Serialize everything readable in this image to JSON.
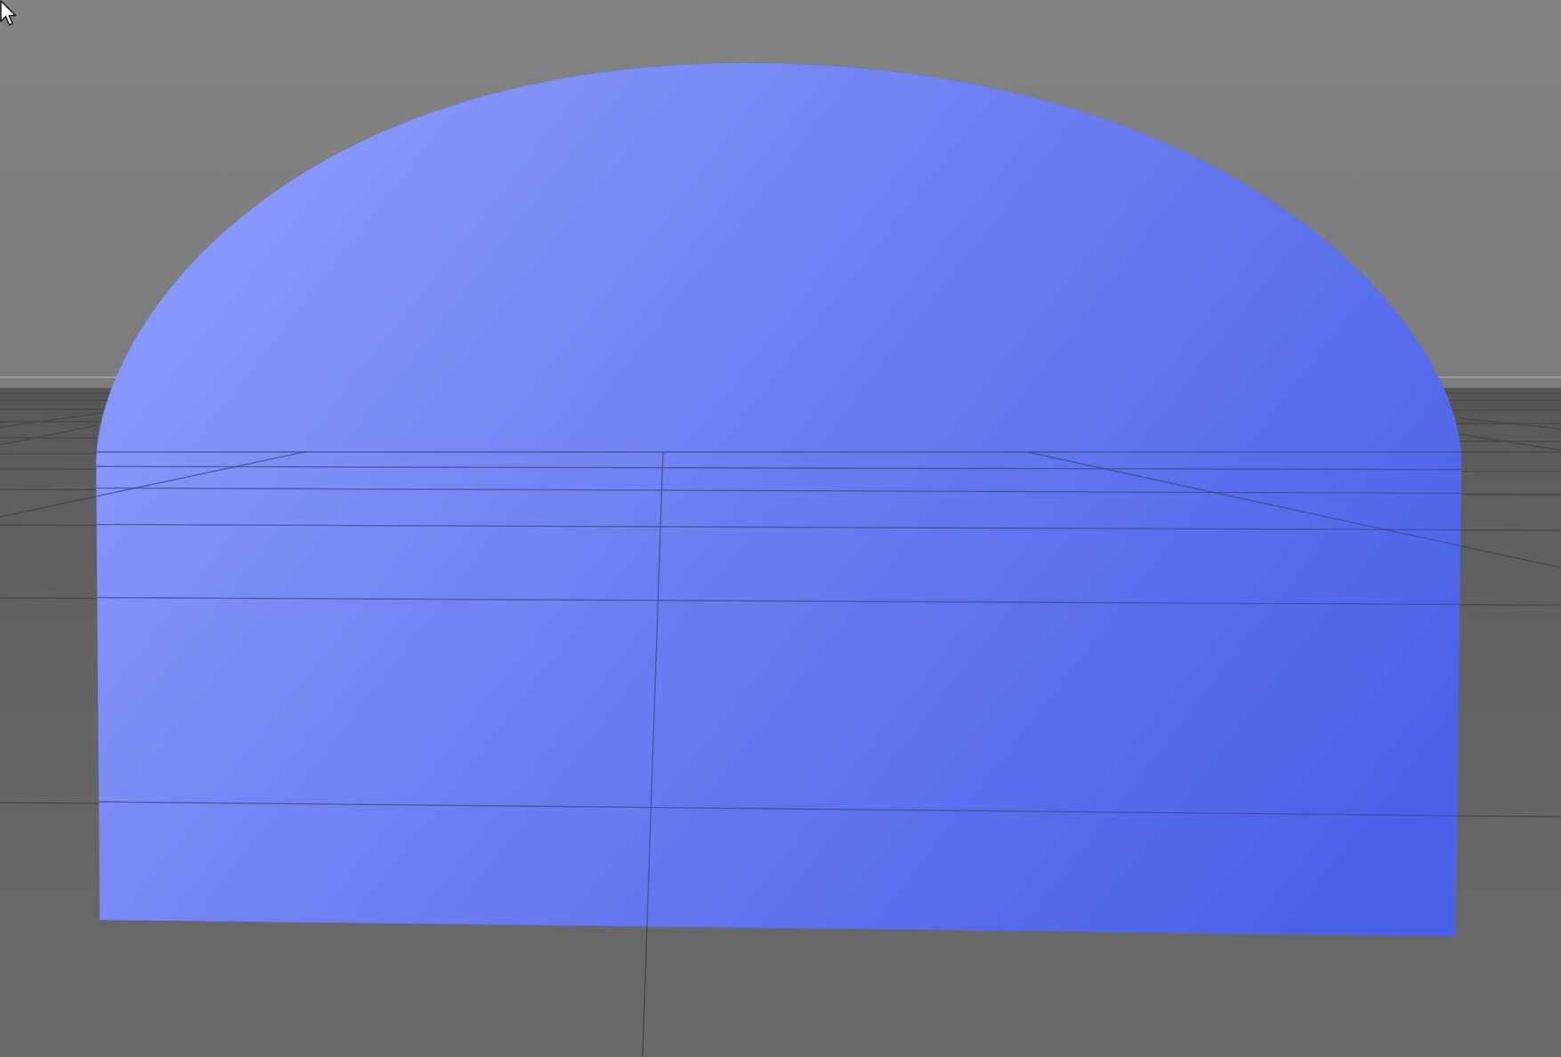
{
  "viewport": {
    "background_top": "#808080",
    "background_floor": "#6a6a6a",
    "grid_color": "#484848",
    "horizon_color": "#a6a6a6"
  },
  "object": {
    "shape": "arched-plane",
    "color_light": "#8b9bfb",
    "color_mid": "#6e7ff0",
    "color_dark": "#4a62e8"
  },
  "cursor": {
    "icon": "arrow-pointer-icon"
  }
}
